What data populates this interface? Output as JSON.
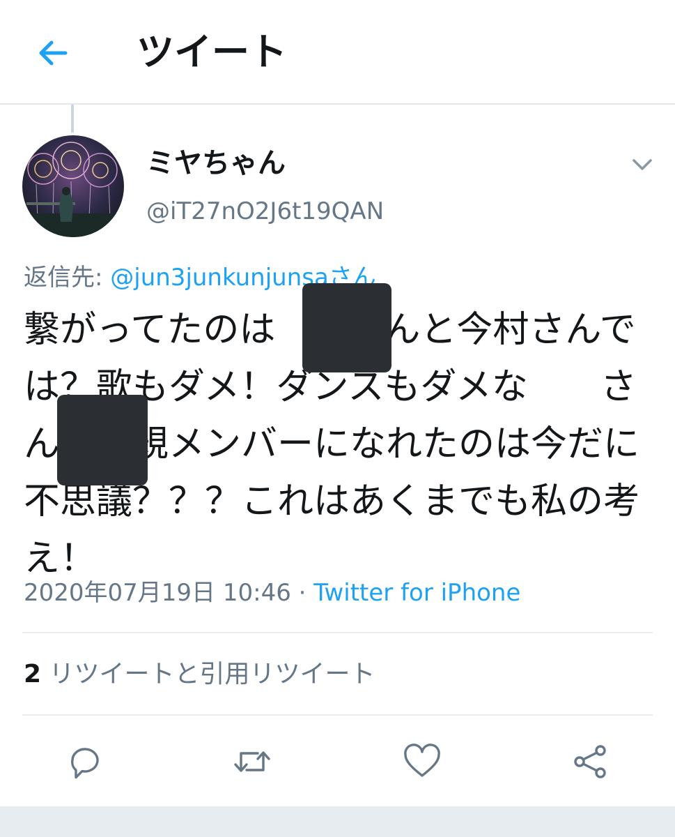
{
  "header": {
    "title": "ツイート",
    "back_icon": "arrow-left-icon",
    "accent_color": "#1da1f2"
  },
  "tweet": {
    "author": {
      "display_name": "ミヤちゃん",
      "handle": "@iT27nO2J6t19QAN"
    },
    "reply_prefix": "返信先: ",
    "reply_target": "@jun3junkunjunsaさん",
    "text": "繋がってたのは　　さんと今村さんでは？歌もダメ！ダンスもダメな　　さんが正規メンバーになれたのは今だに不思議？？？これはあくまでも私の考え！",
    "timestamp": "2020年07月19日 10:46",
    "separator": " · ",
    "source": "Twitter for iPhone",
    "retweet_count": "2",
    "retweet_label": " リツイートと引用リツイート"
  },
  "actions": {
    "reply_icon": "reply-icon",
    "retweet_icon": "retweet-icon",
    "like_icon": "heart-icon",
    "share_icon": "share-icon"
  }
}
